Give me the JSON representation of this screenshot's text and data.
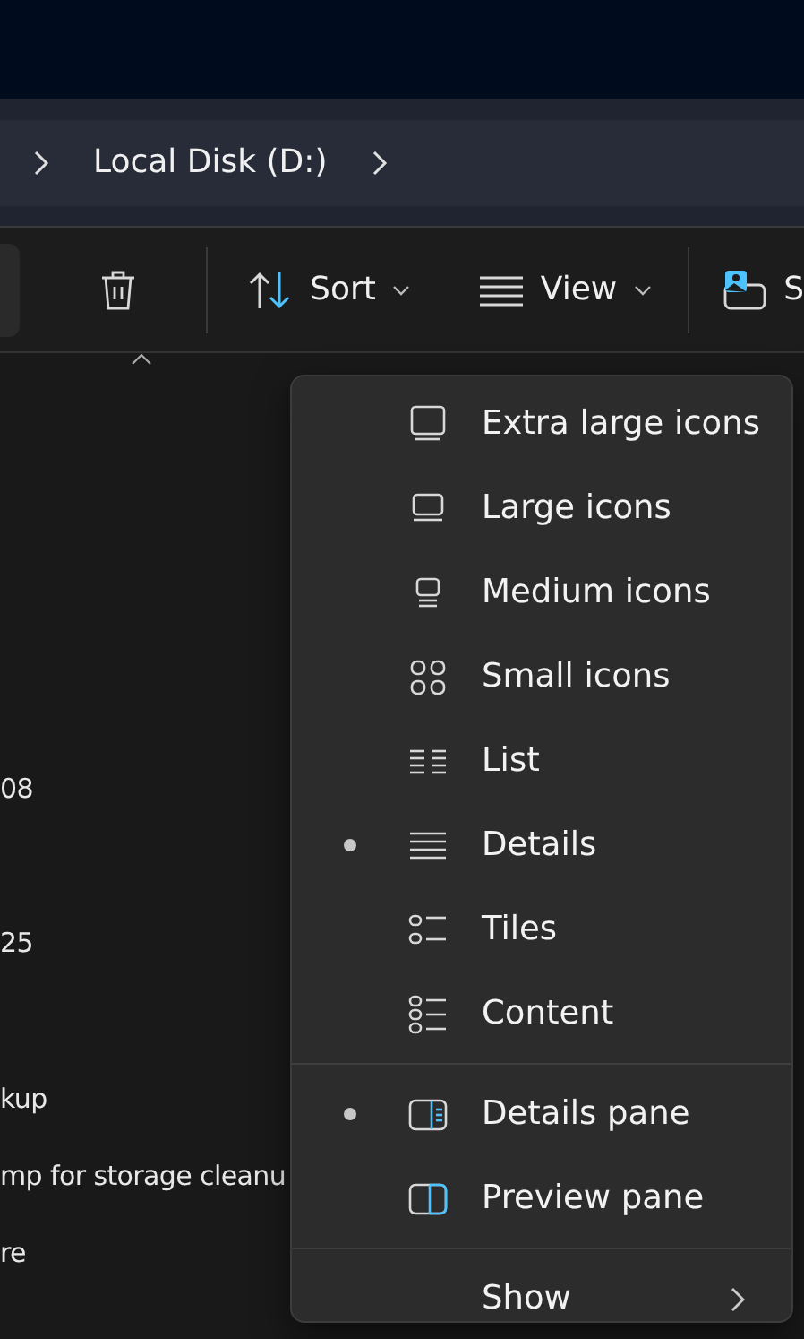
{
  "breadcrumb": {
    "items": [
      "Local Disk (D:)"
    ]
  },
  "toolbar": {
    "buttons": [
      {
        "kind": "delete"
      },
      {
        "kind": "sort",
        "label": "Sort"
      },
      {
        "kind": "view",
        "label": "View"
      },
      {
        "kind": "share",
        "label": "S"
      }
    ]
  },
  "file_list": {
    "rows": [
      "08",
      "25",
      "kup",
      "mp for storage cleanu",
      "re"
    ]
  },
  "view_menu": {
    "sections": [
      {
        "items": [
          {
            "label": "Extra large icons",
            "selected": false
          },
          {
            "label": "Large icons",
            "selected": false
          },
          {
            "label": "Medium icons",
            "selected": false
          },
          {
            "label": "Small icons",
            "selected": false
          },
          {
            "label": "List",
            "selected": false
          },
          {
            "label": "Details",
            "selected": true
          },
          {
            "label": "Tiles",
            "selected": false
          },
          {
            "label": "Content",
            "selected": false
          }
        ]
      },
      {
        "items": [
          {
            "label": "Details pane",
            "selected": true
          },
          {
            "label": "Preview pane",
            "selected": false
          }
        ]
      },
      {
        "items": [
          {
            "label": "Show",
            "selected": false,
            "kind": "submenu"
          }
        ]
      }
    ]
  }
}
